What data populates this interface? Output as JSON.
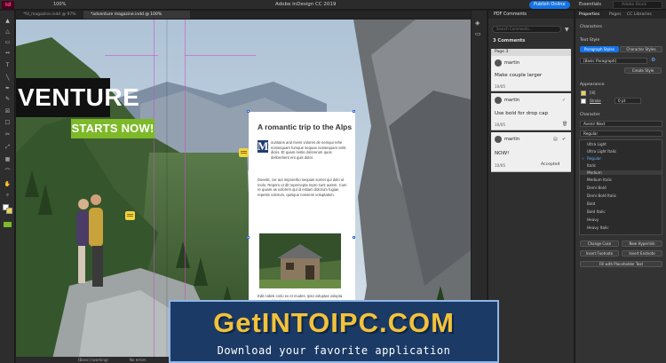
{
  "app": {
    "logo": "Id",
    "zoom": "100%",
    "window_title": "Adobe InDesign CC 2019",
    "publish_label": "Publish Online",
    "workspace": "Essentials",
    "stock_search_placeholder": "Adobe Stock"
  },
  "tabs": [
    {
      "label": "*fd_magazine.indd @ 97%"
    },
    {
      "label": "*adventure magazine.indd @ 100%"
    }
  ],
  "document": {
    "headline": "VENTURE",
    "subhead": "STARTS NOW!",
    "article_title": "A romantic trip to the Alps",
    "dropcap": "M",
    "para1": "ountains and rivers volores de nemqui rehe nonsequam fumque sequae nonsequam velis diciis. Et quam restis dolorerum quos dellorehent ent quis dolor.",
    "para2": "Doeebt, cor aut imporerbo sequias sumet qui dolo ut molo. Repero ut dit repercepta repro sunt autem. Cum re quiam as volorem qui id estiam dolorum fugiae repeste volorum, quisque nonsens voluptatem.",
    "para3": "Edit nobisi corio ex et mudes. Ipso voluptas volupta tem. Et dolupiat. Pict unisi voluptatem que repe. Molupta vollitatem. Pic et laut cuphullum ut ex pliqueret. Pic et laut cuphulu intuen ut re pliqueret nos.",
    "status_left": "[Basic] (working)",
    "status_right": "No errors"
  },
  "comments_panel": {
    "title": "PDF Comments",
    "search_placeholder": "Search Comments...",
    "count": "3 Comments",
    "page_label": "Page 3",
    "comments": [
      {
        "user": "martin",
        "text": "Make couple larger",
        "date": "10/05"
      },
      {
        "user": "martin",
        "text": "Use bold for drop cap",
        "date": "10/05"
      },
      {
        "user": "martin",
        "text": "NOW!",
        "date": "10/05",
        "status": "Accepted"
      }
    ]
  },
  "properties": {
    "tabs": [
      "Properties",
      "Pages",
      "CC Libraries"
    ],
    "section_characters": "Characters",
    "text_style": "Text Style",
    "paragraph_styles": "Paragraph Styles",
    "character_styles": "Character Styles",
    "basic_paragraph": "[Basic Paragraph]",
    "create_style": "Create Style",
    "appearance": "Appearance",
    "fill_value": "[lll]",
    "stroke_label": "Stroke",
    "stroke_value": "0 pt",
    "character": "Character",
    "font_name": "Avenir Next",
    "font_style": "Regular",
    "font_styles": [
      "Ultra Light",
      "Ultra Light Italic",
      "Regular",
      "Italic",
      "Medium",
      "Medium Italic",
      "Demi Bold",
      "Demi Bold Italic",
      "Bold",
      "Bold Italic",
      "Heavy",
      "Heavy Italic"
    ],
    "btn_change_case": "Change Case",
    "btn_new_hyperlink": "New Hyperlink",
    "btn_insert_footnote": "Insert Footnote",
    "btn_insert_endnote": "Insert Endnote",
    "btn_fill_placeholder": "Fill with Placeholder Text"
  },
  "watermark": {
    "title": "GetINTOIPC.COM",
    "subtitle": "Download your favorite application"
  },
  "colors": {
    "accent_green": "#7db928",
    "publish_blue": "#1473e6",
    "dropcap_navy": "#1f3b73",
    "banner_yellow": "#f2c23a"
  }
}
